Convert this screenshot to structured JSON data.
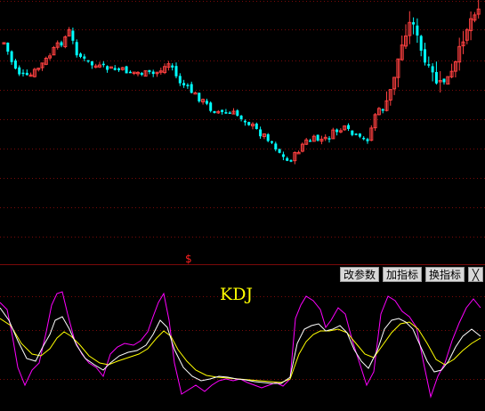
{
  "chart_title": "KDJ",
  "signal_marker": "$",
  "toolbar": {
    "modify_params": "改参数",
    "add_indicator": "加指标",
    "switch_indicator": "换指标",
    "close_symbol": "╳"
  },
  "colors": {
    "background": "#000000",
    "grid": "#7a0a0a",
    "up": "#ff4040",
    "down": "#00ffff",
    "k_line": "#ffffff",
    "d_line": "#ffff00",
    "j_line": "#ff00ff",
    "title": "#ffff00",
    "signal": "#ff2020"
  }
}
